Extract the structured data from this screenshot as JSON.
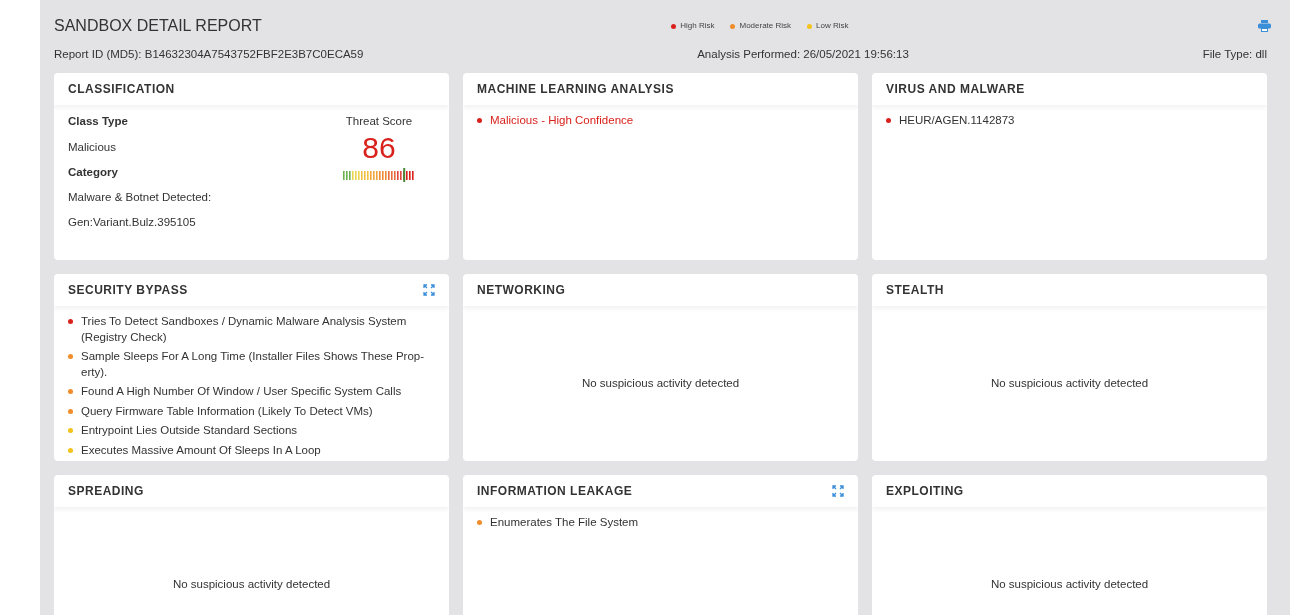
{
  "header": {
    "title": "SANDBOX DETAIL REPORT",
    "report_id": "Report ID (MD5): B14632304A7543752FBF2E3B7C0ECA59",
    "analysis": "Analysis Performed: 26/05/2021 19:56:13",
    "file_type": "File Type: dll",
    "legend": [
      {
        "label": "High Risk",
        "color": "#d9221c"
      },
      {
        "label": "Moderate Risk",
        "color": "#f08c2a"
      },
      {
        "label": "Low Risk",
        "color": "#f3c21b"
      }
    ]
  },
  "panels": [
    {
      "kind": "classification",
      "title": "CLASSIFICATION",
      "expandable": false,
      "fields": [
        {
          "label": "Class Type",
          "value": "Malicious"
        },
        {
          "label": "Category",
          "value": "Malware & Botnet Detected:"
        }
      ],
      "extra": "Gen:Variant.Bulz.395105",
      "threat": {
        "label": "Threat Score",
        "score": "86",
        "level": 0.86
      }
    },
    {
      "kind": "list",
      "title": "MACHINE LEARNING ANALYSIS",
      "expandable": false,
      "items": [
        {
          "text": "Malicious - High Confidence",
          "color": "#d9221c",
          "highlight": true
        }
      ]
    },
    {
      "kind": "list",
      "title": "VIRUS AND MALWARE",
      "expandable": false,
      "items": [
        {
          "text": "HEUR/AGEN.1142873",
          "color": "#d9221c",
          "highlight": false
        }
      ]
    },
    {
      "kind": "list",
      "title": "SECURITY BYPASS",
      "expandable": true,
      "items": [
        {
          "text": "Tries To Detect Sandboxes / Dynamic Malware Analysis System (Registry Check)",
          "color": "#d9221c",
          "highlight": false
        },
        {
          "text": "Sample Sleeps For A Long Time (Installer Files Shows These Prop-erty).",
          "color": "#f08c2a",
          "highlight": false
        },
        {
          "text": "Found A High Number Of Window / User Specific System Calls",
          "color": "#f08c2a",
          "highlight": false
        },
        {
          "text": "Query Firmware Table Information (Likely To Detect VMs)",
          "color": "#f08c2a",
          "highlight": false
        },
        {
          "text": "Entrypoint Lies Outside Standard Sections",
          "color": "#f3c21b",
          "highlight": false
        },
        {
          "text": "Executes Massive Amount Of Sleeps In A Loop",
          "color": "#f3c21b",
          "highlight": false
        }
      ]
    },
    {
      "kind": "empty",
      "title": "NETWORKING",
      "expandable": false,
      "message": "No suspicious activity detected"
    },
    {
      "kind": "empty",
      "title": "STEALTH",
      "expandable": false,
      "message": "No suspicious activity detected"
    },
    {
      "kind": "empty",
      "title": "SPREADING",
      "expandable": false,
      "message": "No suspicious activity detected"
    },
    {
      "kind": "list",
      "title": "INFORMATION LEAKAGE",
      "expandable": true,
      "items": [
        {
          "text": "Enumerates The File System",
          "color": "#f08c2a",
          "highlight": false
        }
      ]
    },
    {
      "kind": "empty",
      "title": "EXPLOITING",
      "expandable": false,
      "message": "No suspicious activity detected"
    }
  ]
}
